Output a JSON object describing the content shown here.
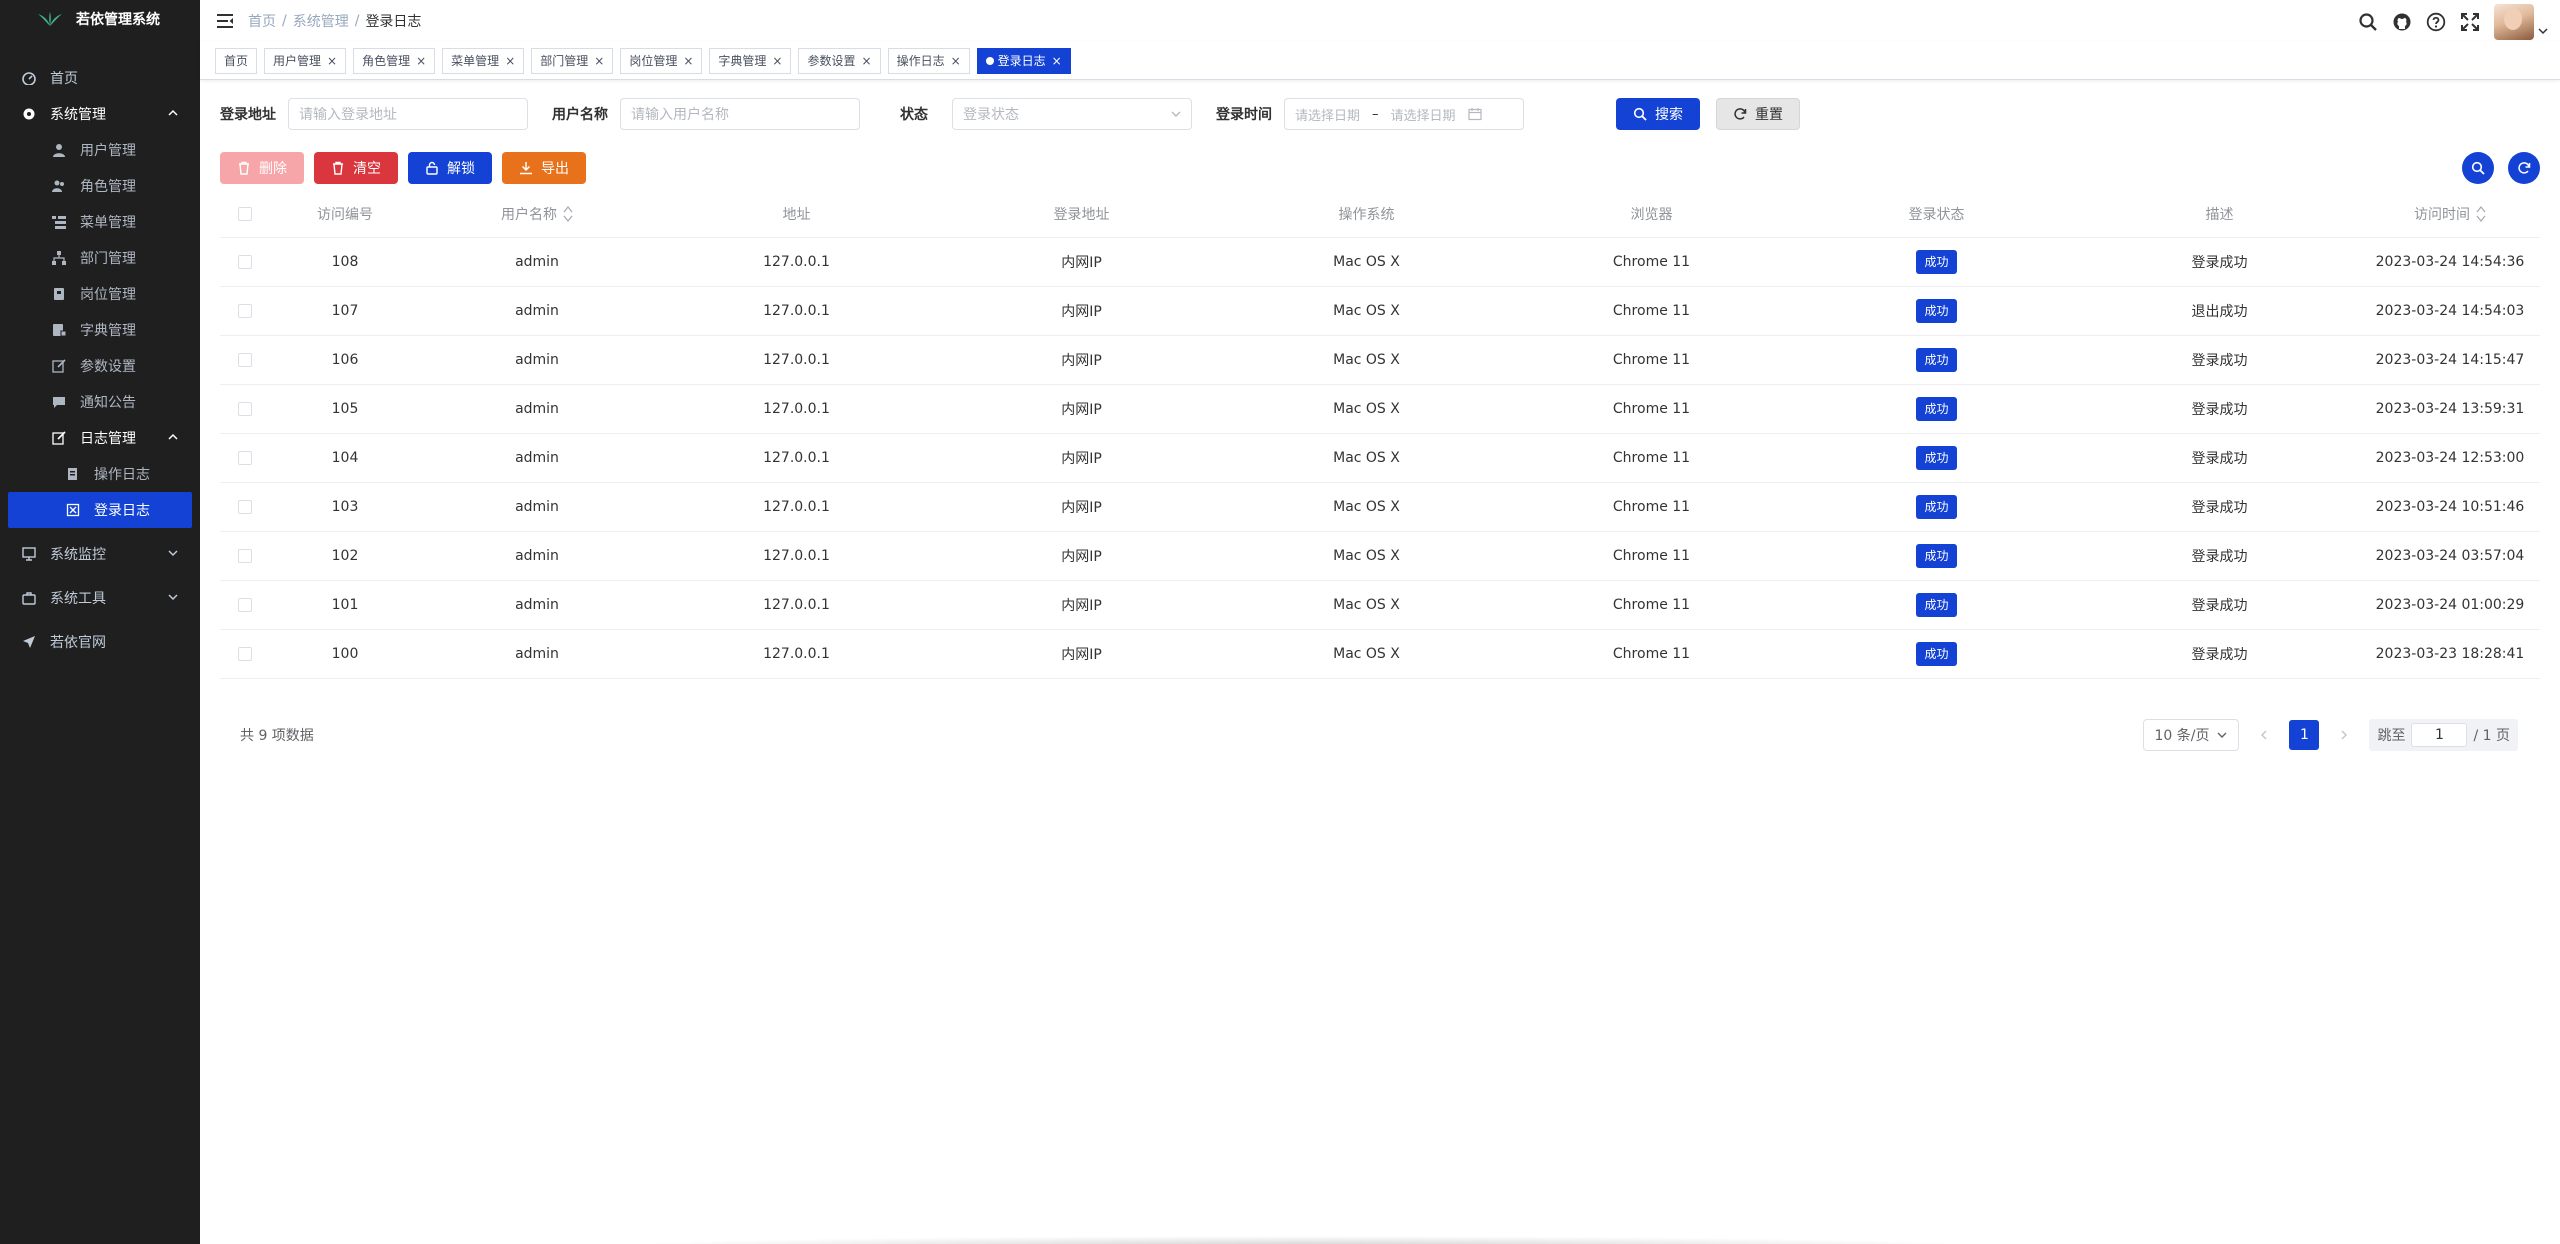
{
  "app": {
    "title": "若依管理系统"
  },
  "sidebar": {
    "items": [
      {
        "label": "首页"
      },
      {
        "label": "系统管理"
      },
      {
        "label": "用户管理"
      },
      {
        "label": "角色管理"
      },
      {
        "label": "菜单管理"
      },
      {
        "label": "部门管理"
      },
      {
        "label": "岗位管理"
      },
      {
        "label": "字典管理"
      },
      {
        "label": "参数设置"
      },
      {
        "label": "通知公告"
      },
      {
        "label": "日志管理"
      },
      {
        "label": "操作日志"
      },
      {
        "label": "登录日志"
      },
      {
        "label": "系统监控"
      },
      {
        "label": "系统工具"
      },
      {
        "label": "若依官网"
      }
    ]
  },
  "breadcrumb": {
    "home": "首页",
    "sep": "/",
    "section": "系统管理",
    "current": "登录日志"
  },
  "tags": [
    {
      "label": "首页"
    },
    {
      "label": "用户管理"
    },
    {
      "label": "角色管理"
    },
    {
      "label": "菜单管理"
    },
    {
      "label": "部门管理"
    },
    {
      "label": "岗位管理"
    },
    {
      "label": "字典管理"
    },
    {
      "label": "参数设置"
    },
    {
      "label": "操作日志"
    },
    {
      "label": "登录日志"
    }
  ],
  "tag_close": "×",
  "search": {
    "ipaddr_label": "登录地址",
    "ipaddr_placeholder": "请输入登录地址",
    "username_label": "用户名称",
    "username_placeholder": "请输入用户名称",
    "status_label": "状态",
    "status_placeholder": "登录状态",
    "time_label": "登录时间",
    "start_placeholder": "请选择日期",
    "range_sep": "–",
    "end_placeholder": "请选择日期",
    "search_button": "搜索",
    "reset_button": "重置"
  },
  "toolbar": {
    "delete_label": "删除",
    "clean_label": "清空",
    "unlock_label": "解锁",
    "export_label": "导出"
  },
  "colors": {
    "primary": "#1342d4",
    "danger": "#d9363e",
    "warning": "#e8711c",
    "danger_light": "#f6a5a8"
  },
  "table": {
    "columns": [
      "访问编号",
      "用户名称",
      "地址",
      "登录地址",
      "操作系统",
      "浏览器",
      "登录状态",
      "描述",
      "访问时间"
    ],
    "rows": [
      [
        "108",
        "admin",
        "127.0.0.1",
        "内网IP",
        "Mac OS X",
        "Chrome 11",
        "成功",
        "登录成功",
        "2023-03-24 14:54:36"
      ],
      [
        "107",
        "admin",
        "127.0.0.1",
        "内网IP",
        "Mac OS X",
        "Chrome 11",
        "成功",
        "退出成功",
        "2023-03-24 14:54:03"
      ],
      [
        "106",
        "admin",
        "127.0.0.1",
        "内网IP",
        "Mac OS X",
        "Chrome 11",
        "成功",
        "登录成功",
        "2023-03-24 14:15:47"
      ],
      [
        "105",
        "admin",
        "127.0.0.1",
        "内网IP",
        "Mac OS X",
        "Chrome 11",
        "成功",
        "登录成功",
        "2023-03-24 13:59:31"
      ],
      [
        "104",
        "admin",
        "127.0.0.1",
        "内网IP",
        "Mac OS X",
        "Chrome 11",
        "成功",
        "登录成功",
        "2023-03-24 12:53:00"
      ],
      [
        "103",
        "admin",
        "127.0.0.1",
        "内网IP",
        "Mac OS X",
        "Chrome 11",
        "成功",
        "登录成功",
        "2023-03-24 10:51:46"
      ],
      [
        "102",
        "admin",
        "127.0.0.1",
        "内网IP",
        "Mac OS X",
        "Chrome 11",
        "成功",
        "登录成功",
        "2023-03-24 03:57:04"
      ],
      [
        "101",
        "admin",
        "127.0.0.1",
        "内网IP",
        "Mac OS X",
        "Chrome 11",
        "成功",
        "登录成功",
        "2023-03-24 01:00:29"
      ],
      [
        "100",
        "admin",
        "127.0.0.1",
        "内网IP",
        "Mac OS X",
        "Chrome 11",
        "成功",
        "登录成功",
        "2023-03-23 18:28:41"
      ]
    ]
  },
  "pagination": {
    "total_text": "共 9 项数据",
    "page_size": "10 条/页",
    "current_page": "1",
    "jump_label": "跳至",
    "jump_value": "1",
    "total_pages": "/ 1 页"
  }
}
